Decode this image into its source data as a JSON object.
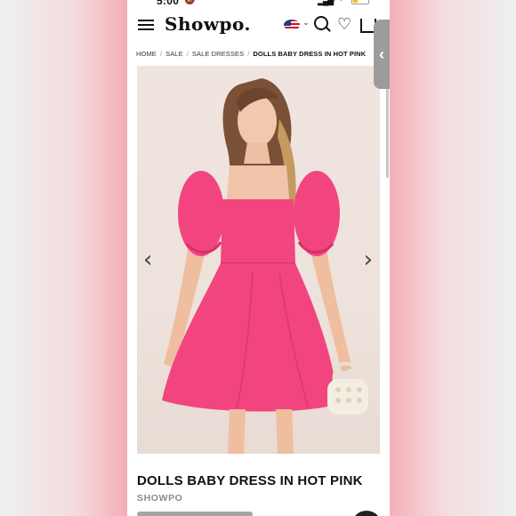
{
  "status_bar": {
    "time": "5:00",
    "bell_icon": "bell-slash-icon",
    "signal_icon": "signal-icon",
    "wifi_icon": "wifi-icon",
    "battery_icon": "battery-low-icon"
  },
  "header": {
    "menu_icon": "hamburger-menu-icon",
    "logo": "Showpo.",
    "flag_icon": "us-flag-icon",
    "icons": [
      "search-icon",
      "heart-icon",
      "bag-icon"
    ]
  },
  "breadcrumb": [
    {
      "label": "HOME"
    },
    {
      "label": "SALE"
    },
    {
      "label": "SALE DRESSES"
    },
    {
      "label": "DOLLS BABY DRESS IN HOT PINK"
    }
  ],
  "gallery": {
    "prev_icon": "chevron-left-icon",
    "next_icon": "chevron-right-icon",
    "prev_glyph": "‹",
    "next_glyph": "›"
  },
  "side_tab": {
    "icon": "chevron-left-icon",
    "glyph": "‹"
  },
  "product": {
    "title": "DOLLS BABY DRESS IN HOT PINK",
    "brand": "SHOWPO"
  },
  "colors": {
    "dress": "#f2457f",
    "dress_shadow": "#d6306a",
    "background_blur": "#f19aa6"
  }
}
